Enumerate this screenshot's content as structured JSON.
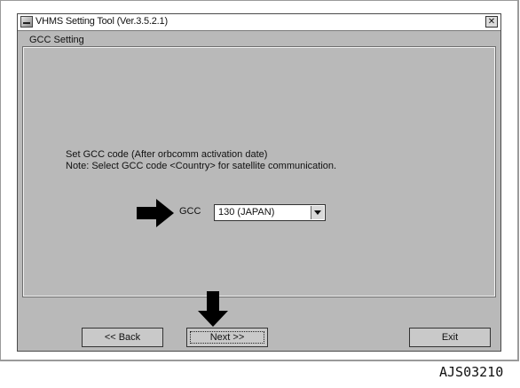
{
  "window": {
    "title": "VHMS Setting Tool  (Ver.3.5.2.1)",
    "close_label": "✕"
  },
  "group": {
    "label": "GCC Setting"
  },
  "instructions": {
    "line1": "Set GCC code (After orbcomm activation date)",
    "line2": "Note: Select GCC code <Country> for satellite communication."
  },
  "gcc": {
    "label": "GCC",
    "selected_value": "130 (JAPAN)"
  },
  "buttons": {
    "back_label": "<< Back",
    "next_label": "Next >>",
    "exit_label": "Exit"
  },
  "annotations": {
    "figure_id": "AJS03210",
    "arrow_color": "#000000"
  },
  "icons": {
    "app": "app-icon",
    "close": "close-icon",
    "dropdown": "chevron-down-icon",
    "pointer_right": "arrow-right-icon",
    "pointer_down": "arrow-down-icon"
  },
  "colors": {
    "window_bg": "#b9b9b9",
    "button_bg": "#c9c9c9",
    "titlebar_bg": "#ffffff"
  }
}
